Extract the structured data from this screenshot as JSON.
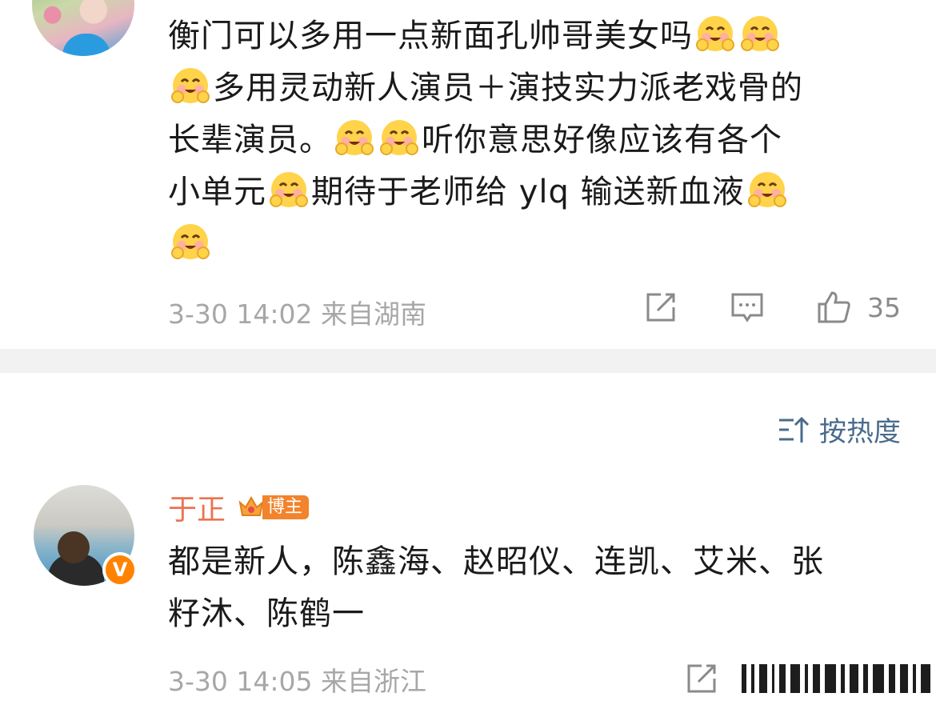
{
  "comment_top": {
    "line1": "衡门可以多用一点新面孔帅哥美女吗",
    "line2": "多用灵动新人演员＋演技实力派老戏骨的",
    "line3a": "长辈演员。",
    "line3b": "听你意思好像应该有各个",
    "line4a": "小单元",
    "line4b": "期待于老师给 ylq 输送新血液",
    "meta": "3-30 14:02  来自湖南",
    "like_count": "35",
    "emoji_name": "smile-blush-emoji"
  },
  "sort": {
    "label": "按热度"
  },
  "comment_bottom": {
    "username": "于正",
    "host_badge": "博主",
    "text_line1": "都是新人，陈鑫海、赵昭仪、连凯、艾米、张",
    "text_line2": "籽沐、陈鹤一",
    "meta": "3-30 14:05  来自浙江",
    "verified_badge": "V"
  },
  "colors": {
    "username": "#eb7350",
    "meta": "#a7a7a7",
    "sort": "#4a6b8c",
    "divider": "#f2f2f2",
    "verified": "#ff8200"
  }
}
